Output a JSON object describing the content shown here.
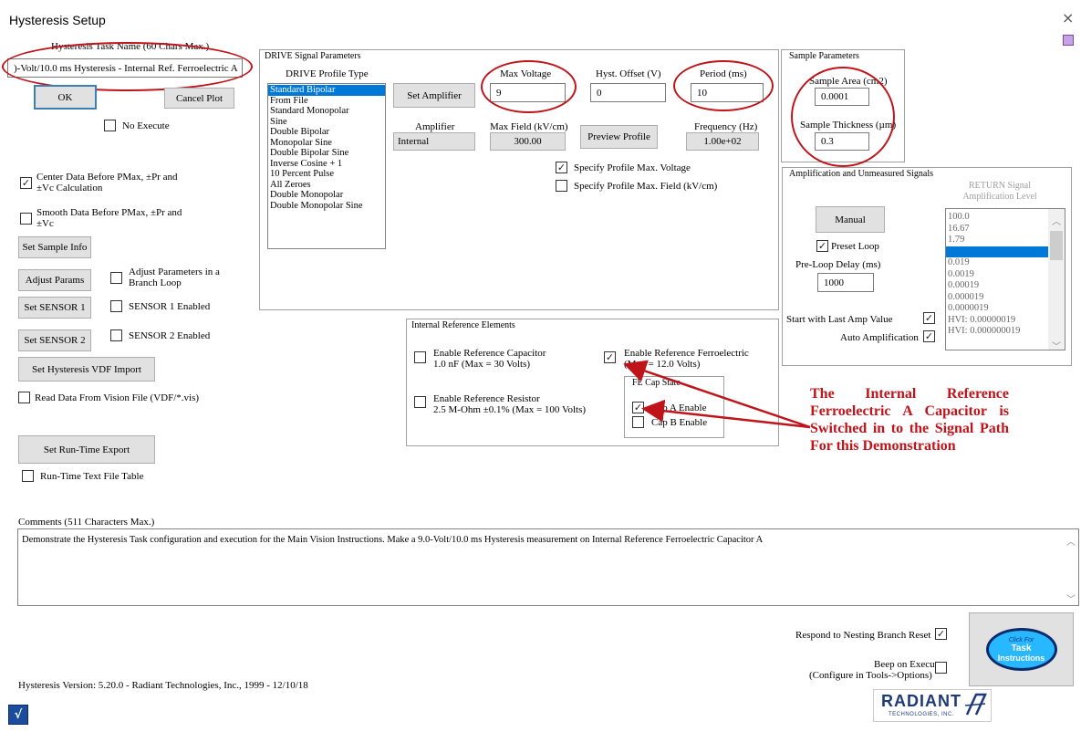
{
  "window": {
    "title": "Hysteresis Setup",
    "close_glyph": "×"
  },
  "task": {
    "name_label": "Hysteresis Task Name (60 Chars Max.)",
    "name_value": ")-Volt/10.0 ms Hysteresis - Internal Ref. Ferroelectric A",
    "ok_label": "OK",
    "cancel_label": "Cancel Plot",
    "no_execute_label": "No Execute"
  },
  "left": {
    "center_data_label": "Center Data Before PMax, ±Pr and ±Vc Calculation",
    "smooth_data_label": "Smooth Data Before PMax, ±Pr and ±Vc",
    "set_sample_info": "Set Sample Info",
    "adjust_params": "Adjust Params",
    "adjust_branch_label": "Adjust Parameters in a Branch Loop",
    "set_sensor1": "Set SENSOR 1",
    "sensor1_enabled": "SENSOR 1 Enabled",
    "set_sensor2": "Set SENSOR 2",
    "sensor2_enabled": "SENSOR 2 Enabled",
    "vdf_import": "Set Hysteresis VDF Import",
    "read_vision": "Read Data From Vision File (VDF/*.vis)",
    "runtime_export": "Set Run-Time Export",
    "runtime_table": "Run-Time Text File Table"
  },
  "drive": {
    "group_title": "DRIVE Signal Parameters",
    "profile_type_label": "DRIVE Profile Type",
    "profiles": [
      "Standard Bipolar",
      "From File",
      "Standard Monopolar",
      "Sine",
      "Double Bipolar",
      "Monopolar Sine",
      "Double Bipolar Sine",
      "Inverse Cosine + 1",
      "10 Percent Pulse",
      "All Zeroes",
      "Double Monopolar",
      "Double Monopolar Sine"
    ],
    "set_amplifier": "Set Amplifier",
    "max_voltage_label": "Max Voltage",
    "max_voltage_value": "9",
    "hyst_offset_label": "Hyst. Offset (V)",
    "hyst_offset_value": "0",
    "period_label": "Period (ms)",
    "period_value": "10",
    "amplifier_label": "Amplifier",
    "amplifier_value": "Internal",
    "max_field_label": "Max Field (kV/cm)",
    "max_field_value": "300.00",
    "preview_profile": "Preview Profile",
    "frequency_label": "Frequency (Hz)",
    "frequency_value": "1.00e+02",
    "specify_voltage": "Specify Profile Max. Voltage",
    "specify_field": "Specify Profile Max. Field (kV/cm)"
  },
  "sample": {
    "group_title": "Sample Parameters",
    "area_label": "Sample Area (cm2)",
    "area_value": "0.0001",
    "thickness_label": "Sample Thickness (µm)",
    "thickness_value": "0.3"
  },
  "amp": {
    "group_title": "Amplification and Unmeasured Signals",
    "return_label": "RETURN Signal Amplification Level",
    "manual": "Manual",
    "preset_loop": "Preset Loop",
    "pre_loop_delay_label": "Pre-Loop Delay (ms)",
    "pre_loop_delay_value": "1000",
    "start_last_amp": "Start with Last Amp Value",
    "auto_amp": "Auto Amplification",
    "levels": [
      "100.0",
      "16.67",
      "1.79",
      "",
      "0.019",
      "0.0019",
      "0.00019",
      "0.000019",
      "0.0000019",
      "HVI: 0.00000019",
      "HVI: 0.000000019"
    ]
  },
  "ref": {
    "group_title": "Internal Reference Elements",
    "cap_label": "Enable Reference Capacitor",
    "cap_sub": "1.0 nF (Max = 30 Volts)",
    "res_label": "Enable Reference Resistor",
    "res_sub": "2.5 M-Ohm ±0.1% (Max = 100 Volts)",
    "fe_label": "Enable Reference Ferroelectric",
    "fe_sub": "(Max = 12.0 Volts)",
    "fe_state_title": "FE Cap State",
    "cap_a": "Cap A Enable",
    "cap_b": "Cap B Enable"
  },
  "annotation": "The Internal Reference Ferroelectric A Capacitor is Switched in to the Signal Path For this Demonstration",
  "comments": {
    "label": "Comments (511 Characters Max.)",
    "text": "Demonstrate the Hysteresis Task configuration and execution for the Main Vision Instructions. Make a 9.0-Volt/10.0 ms Hysteresis measurement on Internal Reference Ferroelectric Capacitor A"
  },
  "bottom": {
    "respond_nesting": "Respond to Nesting Branch Reset",
    "beep_execute": "Beep on Execute",
    "beep_sub": "(Configure in Tools->Options)",
    "click_for": "Click For",
    "task_instr_1": "Task",
    "task_instr_2": "Instructions",
    "version": "Hysteresis Version: 5.20.0 - Radiant Technologies, Inc., 1999 - 12/10/18",
    "logo_main": "RADIANT",
    "logo_sub": "TECHNOLOGIES, INC."
  },
  "colors": {
    "selection": "#0078d7",
    "annotation_red": "#c0141b",
    "button_face": "#e1e1e1"
  }
}
